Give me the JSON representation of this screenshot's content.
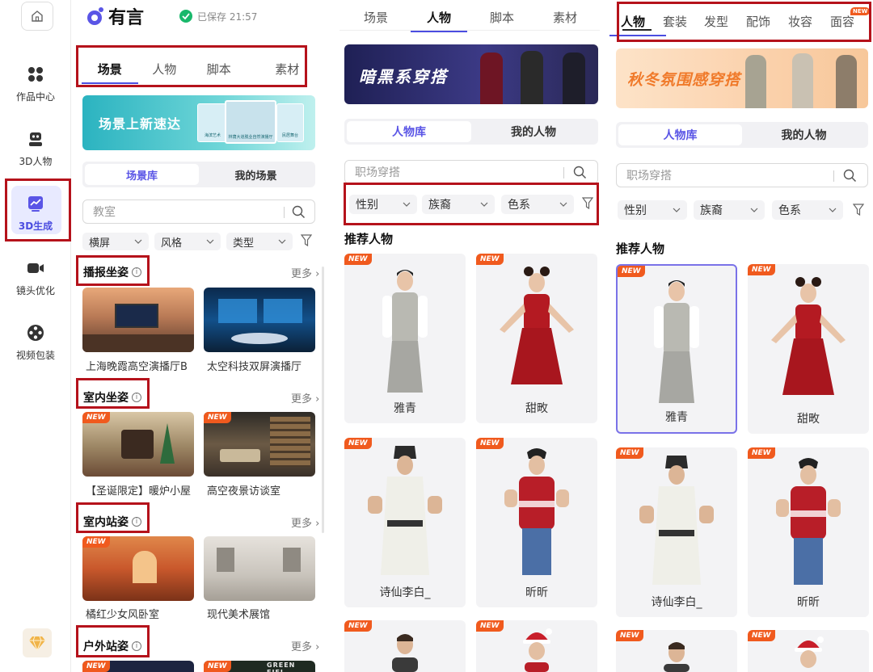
{
  "app": {
    "name": "有言",
    "saved_status": "已保存 21:57"
  },
  "rail": {
    "items": [
      {
        "label": "作品中心",
        "icon": "grid-apps-icon"
      },
      {
        "label": "3D人物",
        "icon": "robot-icon"
      },
      {
        "label": "3D生成",
        "icon": "trend-chart-icon",
        "active": true
      },
      {
        "label": "镜头优化",
        "icon": "video-camera-icon"
      },
      {
        "label": "视频包装",
        "icon": "film-reel-icon"
      }
    ]
  },
  "panel1": {
    "tabs": [
      "场景",
      "人物",
      "脚本",
      "素材"
    ],
    "active_tab": "场景",
    "banner_text": "场景上新速达",
    "banner_thumb_labels": [
      "海滨艺术",
      "林荫大道脱业自然演播厅",
      "民居舞台"
    ],
    "seg": [
      "场景库",
      "我的场景"
    ],
    "search_placeholder": "教室",
    "filters": [
      "横屏",
      "风格",
      "类型"
    ],
    "sections": [
      {
        "title": "播报坐姿",
        "more": "更多",
        "items": [
          {
            "name": "上海晚霞高空演播厅B",
            "new": false
          },
          {
            "name": "太空科技双屏演播厅",
            "new": false
          }
        ]
      },
      {
        "title": "室内坐姿",
        "more": "更多",
        "items": [
          {
            "name": "【圣诞限定】暖炉小屋",
            "new": true
          },
          {
            "name": "高空夜景访谈室",
            "new": true
          }
        ]
      },
      {
        "title": "室内站姿",
        "more": "更多",
        "items": [
          {
            "name": "橘红少女风卧室",
            "new": true
          },
          {
            "name": "现代美术展馆",
            "new": false
          }
        ]
      },
      {
        "title": "户外站姿",
        "more": "更多",
        "items": [
          {
            "name": "",
            "new": true,
            "sign": ""
          },
          {
            "name": "",
            "new": true,
            "sign": "GREEN FIEL"
          }
        ]
      }
    ]
  },
  "panel2": {
    "tabs": [
      "场景",
      "人物",
      "脚本",
      "素材"
    ],
    "active_tab": "人物",
    "banner_text": "暗黑系穿搭",
    "seg": [
      "人物库",
      "我的人物"
    ],
    "search_placeholder": "职场穿搭",
    "filters": [
      "性别",
      "族裔",
      "色系"
    ],
    "rec_title": "推荐人物",
    "characters": [
      "雅青",
      "甜畋",
      "诗仙李白_",
      "昕昕"
    ]
  },
  "panel3": {
    "tabs": [
      "人物",
      "套装",
      "发型",
      "配饰",
      "妆容",
      "面容"
    ],
    "active_tab": "人物",
    "new_badge": "NEW",
    "banner_text": "秋冬氛围感穿搭",
    "seg": [
      "人物库",
      "我的人物"
    ],
    "search_placeholder": "职场穿搭",
    "filters": [
      "性别",
      "族裔",
      "色系"
    ],
    "rec_title": "推荐人物",
    "characters": [
      "雅青",
      "甜畋",
      "诗仙李白_",
      "昕昕"
    ]
  },
  "new_tag": "NEW",
  "colors": {
    "accent": "#5a55e6",
    "highlight_box": "#b5121b",
    "new_tag": "#f05a1e",
    "saved_check": "#19b86b"
  }
}
